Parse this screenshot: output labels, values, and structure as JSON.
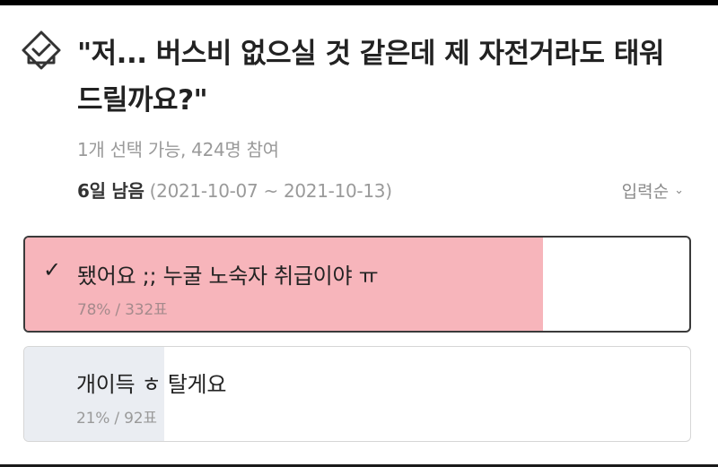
{
  "poll": {
    "question": "\"저... 버스비 없으실 것 같은데 제 자전거라도 태워 드릴까요?\"",
    "meta": "1개 선택 가능, 424명 참여",
    "deadline_remaining": "6일 남음",
    "deadline_range": " (2021-10-07 ~ 2021-10-13)",
    "sort_label": "입력순",
    "options": [
      {
        "label": "됐어요 ;; 누굴 노숙자 취급이야 ㅠ",
        "stat": "78% / 332표",
        "percent": 78,
        "votes": 332,
        "selected": true
      },
      {
        "label": "개이득 ㅎ 탈게요",
        "stat": "21% / 92표",
        "percent": 21,
        "votes": 92,
        "selected": false
      }
    ]
  },
  "icons": {
    "vote": "vote-check-icon",
    "check": "check-icon",
    "sort": "chevron-down-icon"
  },
  "colors": {
    "selected_fill": "#f7b5bb",
    "unselected_fill": "#eaedf2",
    "selected_border": "#3a3a3a"
  }
}
